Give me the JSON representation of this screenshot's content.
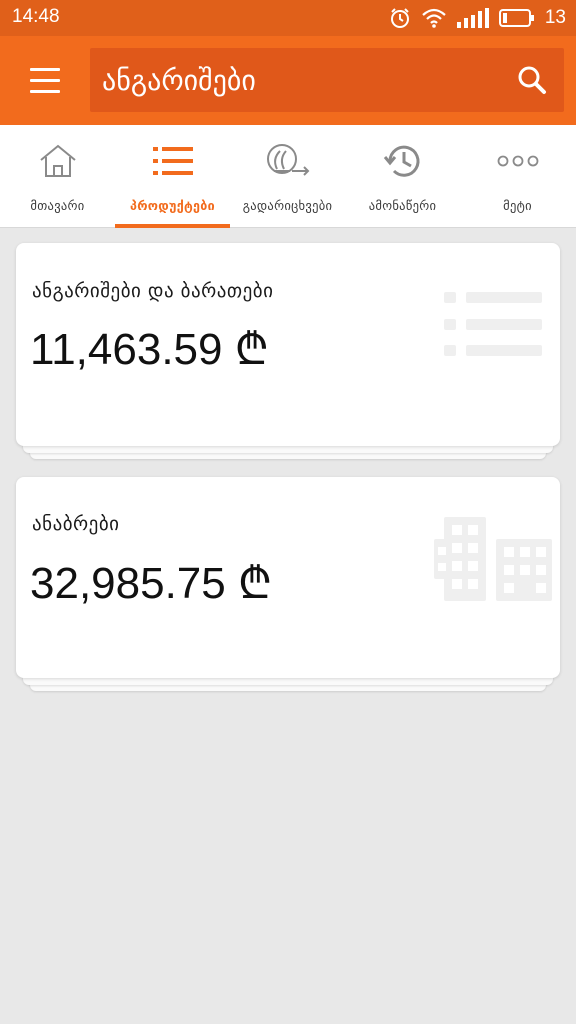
{
  "status_bar": {
    "time": "14:48",
    "battery_level": "13",
    "icons": [
      "alarm-icon",
      "wifi-icon",
      "signal-icon",
      "battery-icon"
    ]
  },
  "header": {
    "title": "ანგარიშები",
    "menu_icon": "hamburger-menu-icon",
    "search_icon": "search-icon"
  },
  "tabs": [
    {
      "label": "მთავარი",
      "icon": "home-icon",
      "active": false
    },
    {
      "label": "პროდუქტები",
      "icon": "list-icon",
      "active": true
    },
    {
      "label": "გადარიცხვები",
      "icon": "lari-transfer-icon",
      "active": false
    },
    {
      "label": "ამონაწერი",
      "icon": "history-icon",
      "active": false
    },
    {
      "label": "მეტი",
      "icon": "more-dots-icon",
      "active": false
    }
  ],
  "cards": [
    {
      "title": "ანგარიშები და ბარათები",
      "amount": "11,463.59 ₾",
      "icon": "list-icon"
    },
    {
      "title": "ანაბრები",
      "amount": "32,985.75 ₾",
      "icon": "buildings-icon"
    }
  ],
  "colors": {
    "status_bar": "#e0601a",
    "app_bar": "#f26b1d",
    "search_box": "#e0581a",
    "accent": "#f26b1d",
    "background": "#e8e8e8"
  }
}
